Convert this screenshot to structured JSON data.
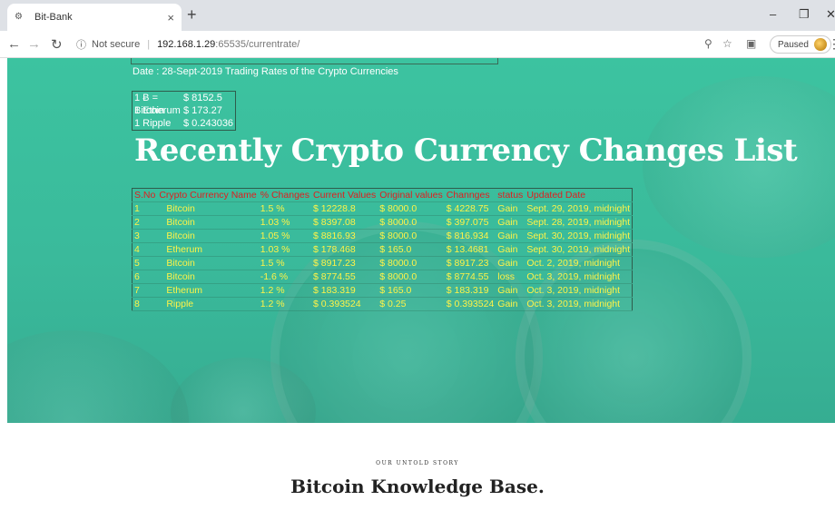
{
  "browser": {
    "tab_title": "Bit-Bank",
    "tab_close": "×",
    "new_tab": "+",
    "not_secure": "Not secure",
    "url_host": "192.168.1.29",
    "url_path": ":65535/currentrate/",
    "paused": "Paused",
    "icons": [
      "back-icon",
      "forward-icon",
      "reload-icon",
      "info-icon",
      "zoom-icon",
      "star-icon",
      "cast-icon",
      "menu-icon"
    ]
  },
  "page": {
    "date_line": "Date : 28-Sept-2019 Trading Rates of the Crypto Currencies",
    "rates": [
      {
        "name": "1 Ƀ = Bitcoin",
        "value": "$ 8152.5"
      },
      {
        "name": "1 Etherum",
        "value": "$ 173.27"
      },
      {
        "name": "1 Ripple",
        "value": "$ 0.243036"
      }
    ],
    "heading": "Recently Crypto Currency Changes List",
    "table": {
      "headers": [
        "S.No",
        "Crypto Currency Name",
        "% Changes",
        "Current Values",
        "Original values",
        "Channges",
        "status",
        "Updated Date"
      ],
      "rows": [
        [
          "1",
          "Bitcoin",
          "1.5 %",
          "$ 12228.8",
          "$ 8000.0",
          "$ 4228.75",
          "Gain",
          "Sept. 29, 2019, midnight"
        ],
        [
          "2",
          "Bitcoin",
          "1.03 %",
          "$ 8397.08",
          "$ 8000.0",
          "$ 397.075",
          "Gain",
          "Sept. 28, 2019, midnight"
        ],
        [
          "3",
          "Bitcoin",
          "1.05 %",
          "$ 8816.93",
          "$ 8000.0",
          "$ 816.934",
          "Gain",
          "Sept. 30, 2019, midnight"
        ],
        [
          "4",
          "Etherum",
          "1.03 %",
          "$ 178.468",
          "$ 165.0",
          "$ 13.4681",
          "Gain",
          "Sept. 30, 2019, midnight"
        ],
        [
          "5",
          "Bitcoin",
          "1.5 %",
          "$ 8917.23",
          "$ 8000.0",
          "$ 8917.23",
          "Gain",
          "Oct. 2, 2019, midnight"
        ],
        [
          "6",
          "Bitcoin",
          "-1.6 %",
          "$ 8774.55",
          "$ 8000.0",
          "$ 8774.55",
          "loss",
          "Oct. 3, 2019, midnight"
        ],
        [
          "7",
          "Etherum",
          "1.2 %",
          "$ 183.319",
          "$ 165.0",
          "$ 183.319",
          "Gain",
          "Oct. 3, 2019, midnight"
        ],
        [
          "8",
          "Ripple",
          "1.2 %",
          "$ 0.393524",
          "$ 0.25",
          "$ 0.393524",
          "Gain",
          "Oct. 3, 2019, midnight"
        ]
      ]
    },
    "story_label": "OUR UNTOLD STORY",
    "kb_title": "Bitcoin Knowledge Base."
  },
  "colors": {
    "hero": "#3cc3a0",
    "table_header": "#e01e1e",
    "table_cell": "#fff347"
  }
}
